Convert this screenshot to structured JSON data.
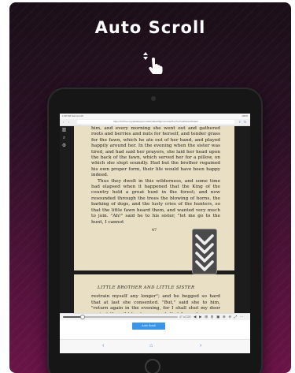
{
  "headline": "Auto Scroll",
  "colors": {
    "accent": "#3b94e6",
    "card_bottom": "#6a1447",
    "paper": "#e8dfc4"
  },
  "icons": [
    "scroll-gesture-icon",
    "library-icon",
    "search-icon",
    "settings-icon",
    "double-chevron-down-icon",
    "home-icon"
  ],
  "tablet": {
    "status": {
      "left": "1:38 PM  Sat Feb 29",
      "right": "100%"
    },
    "url": "https://archive.org/details/grimmsfairytales00grim/mode/2up?ref=ol&view=theater",
    "book": {
      "top_page_paragraphs": [
        "him, and every morning she went out and gathered roots and berries and nuts for herself, and tender grass for the fawn, which he ate out of her hand, and played happily around her. In the evening when the sister was tired, and had said her prayers, she laid her head upon the back of the fawn, which served her for a pillow, on which she slept soundly. Had but the brother regained his own proper form, their life would have been happy indeed.",
        "Thus they dwelt in this wilderness, and some time had elapsed when it happened that the King of the country held a great hunt in the forest; and now resounded through the trees the blowing of horns, the barking of dogs, and the lusty cries of the hunters, so that the little fawn heard them, and wanted very much to join. \"Ah!\" said he to his sister, \"let me go to the hunt, I cannot"
      ],
      "page_number": "47",
      "bottom_page": {
        "chapter": "LITTLE BROTHER AND LITTLE SISTER",
        "text": "restrain myself any longer\"; and he begged so hard that at last she consented. \"But,\" said she to him, \"return again in the evening, for I shall shut my door against the wild huntsmen, and, that I may know you, do you"
      }
    },
    "media": {
      "time": "47 of 220",
      "progress": 0.17,
      "icons": "◀ ▶ ⊞ ⊟ ▣ ⊕ ⊖ ⤢ ⋯"
    },
    "autoscroll_label": "Auto Scroll",
    "nav": {
      "back": "‹",
      "home": "⌂",
      "forward": "›"
    }
  }
}
